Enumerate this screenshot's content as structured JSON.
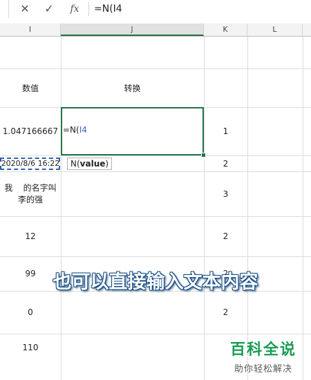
{
  "formula_bar": {
    "cancel_icon": "✕",
    "enter_icon": "✓",
    "fx_label": "fx",
    "input_value": "=N(I4"
  },
  "column_headers": [
    "I",
    "J",
    "K",
    "L"
  ],
  "cells": {
    "header_I": "数值",
    "header_J": "转换",
    "I_rows": [
      "1.047166667",
      "2020/8/6 16:22",
      "我    的名字叫\n李的强",
      "12",
      "99",
      "0",
      "110"
    ],
    "K_rows": [
      "1",
      "2",
      "3",
      "2",
      "2",
      "2"
    ]
  },
  "editing": {
    "prefix": "=N(",
    "ref": "I4"
  },
  "tooltip": {
    "func": "N(",
    "arg": "value",
    "close": ")"
  },
  "caption": "也可以直接输入文本内容",
  "watermark": {
    "title": "百科全说",
    "subtitle": "助你轻松解决"
  }
}
